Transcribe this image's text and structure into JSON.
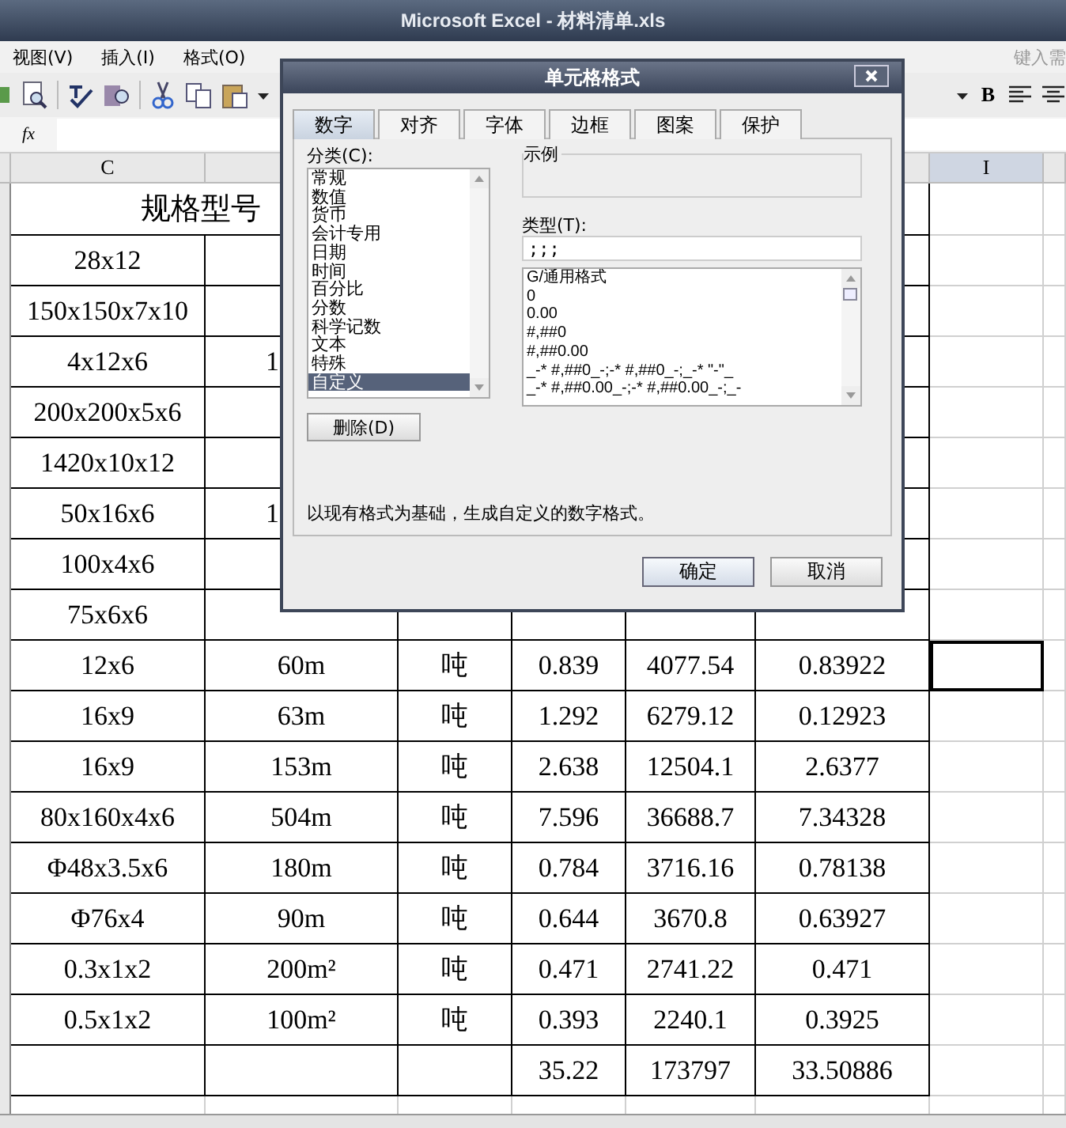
{
  "window": {
    "title": "Microsoft Excel - 材料清单.xls"
  },
  "menu": [
    "视图(V)",
    "插入(I)",
    "格式(O)"
  ],
  "help_box": {
    "placeholder": "键入需"
  },
  "toolbar": {
    "bold": "B"
  },
  "formula_bar": {
    "fx": "fx"
  },
  "column_headers": [
    {
      "label": "C",
      "selected": false
    },
    {
      "label": "I",
      "selected": true
    }
  ],
  "table": {
    "header_text": "规格型号",
    "rows": [
      {
        "cells": [
          "28x12"
        ],
        "selected": false
      },
      {
        "cells": [
          "150x150x7x10"
        ],
        "selected": false
      },
      {
        "cells": [
          "4x12x6",
          "1"
        ],
        "selected": false
      },
      {
        "cells": [
          "200x200x5x6"
        ],
        "selected": false
      },
      {
        "cells": [
          "1420x10x12"
        ],
        "selected": false
      },
      {
        "cells": [
          "50x16x6",
          "1"
        ],
        "selected": false
      },
      {
        "cells": [
          "100x4x6"
        ],
        "selected": false
      },
      {
        "cells": [
          "75x6x6"
        ],
        "selected": false
      },
      {
        "cells": [
          "12x6",
          "60m",
          "吨",
          "0.839",
          "4077.54",
          "0.83922"
        ],
        "selected": true
      },
      {
        "cells": [
          "16x9",
          "63m",
          "吨",
          "1.292",
          "6279.12",
          "0.12923"
        ],
        "selected": false
      },
      {
        "cells": [
          "16x9",
          "153m",
          "吨",
          "2.638",
          "12504.1",
          "2.6377"
        ],
        "selected": false
      },
      {
        "cells": [
          "80x160x4x6",
          "504m",
          "吨",
          "7.596",
          "36688.7",
          "7.34328"
        ],
        "selected": false
      },
      {
        "cells": [
          "Φ48x3.5x6",
          "180m",
          "吨",
          "0.784",
          "3716.16",
          "0.78138"
        ],
        "selected": false
      },
      {
        "cells": [
          "Φ76x4",
          "90m",
          "吨",
          "0.644",
          "3670.8",
          "0.63927"
        ],
        "selected": false
      },
      {
        "cells": [
          "0.3x1x2",
          "200m²",
          "吨",
          "0.471",
          "2741.22",
          "0.471"
        ],
        "selected": false
      },
      {
        "cells": [
          "0.5x1x2",
          "100m²",
          "吨",
          "0.393",
          "2240.1",
          "0.3925"
        ],
        "selected": false
      }
    ],
    "totals": [
      "35.22",
      "173797",
      "33.50886"
    ]
  },
  "dialog": {
    "title": "单元格格式",
    "tabs": [
      {
        "label": "数字",
        "selected": true
      },
      {
        "label": "对齐",
        "selected": false
      },
      {
        "label": "字体",
        "selected": false
      },
      {
        "label": "边框",
        "selected": false
      },
      {
        "label": "图案",
        "selected": false
      },
      {
        "label": "保护",
        "selected": false
      }
    ],
    "category_label": "分类(C):",
    "categories": [
      {
        "label": "常规",
        "selected": false
      },
      {
        "label": "数值",
        "selected": false
      },
      {
        "label": "货币",
        "selected": false
      },
      {
        "label": "会计专用",
        "selected": false
      },
      {
        "label": "日期",
        "selected": false
      },
      {
        "label": "时间",
        "selected": false
      },
      {
        "label": "百分比",
        "selected": false
      },
      {
        "label": "分数",
        "selected": false
      },
      {
        "label": "科学记数",
        "selected": false
      },
      {
        "label": "文本",
        "selected": false
      },
      {
        "label": "特殊",
        "selected": false
      },
      {
        "label": "自定义",
        "selected": true
      }
    ],
    "delete_button": "删除(D)",
    "sample_label": "示例",
    "type_label": "类型(T):",
    "type_value": ";;;",
    "formats": [
      "G/通用格式",
      "0",
      "0.00",
      "#,##0",
      "#,##0.00",
      "_-* #,##0_-;-* #,##0_-;_-* \"-\"_",
      "_-* #,##0.00_-;-* #,##0.00_-;_-"
    ],
    "description": "以现有格式为基础，生成自定义的数字格式。",
    "buttons": [
      "确定",
      "取消"
    ]
  }
}
